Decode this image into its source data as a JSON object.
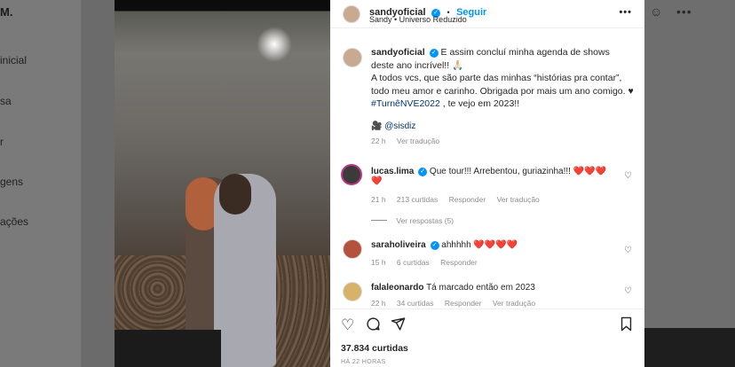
{
  "background": {
    "logo_fragment": "M.",
    "nav": [
      "inicial",
      "sa",
      "r",
      "gens",
      "ações"
    ]
  },
  "post": {
    "author": "sandyoficial",
    "dot": "•",
    "follow_label": "Seguir",
    "subtitle": "Sandy • Universo Reduzido",
    "more_icon": "•••"
  },
  "caption": {
    "username": "sandyoficial",
    "line1": "E assim concluí minha agenda de shows deste ano incrível!! 🙏🏻",
    "line2": "A todos vcs, que são parte das minhas “histórias pra contar”, todo meu amor e carinho. Obrigada por mais um ano comigo. ♥",
    "hashtag": "#TurnêNVE2022",
    "line3_rest": " , te vejo em 2023!!",
    "credit_icon": "🎥",
    "credit": "@sisdiz",
    "time": "22 h",
    "translate": "Ver tradução"
  },
  "comments": [
    {
      "username": "lucas.lima",
      "verified": true,
      "text": "Que tour!!! Arrebentou, guriazinha!!! ❤️❤️❤️",
      "text2": "❤️",
      "time": "21 h",
      "likes": "213 curtidas",
      "reply": "Responder",
      "translate": "Ver tradução",
      "view_replies": "Ver respostas (5)"
    },
    {
      "username": "saraholiveira",
      "verified": true,
      "text": "ahhhhh ❤️❤️❤️❤️",
      "time": "15 h",
      "likes": "6 curtidas",
      "reply": "Responder"
    },
    {
      "username": "falaleonardo",
      "verified": false,
      "text": "Tá marcado então em 2023",
      "time": "22 h",
      "likes": "34 curtidas",
      "reply": "Responder",
      "translate": "Ver tradução"
    }
  ],
  "actions": {
    "likes": "37.834 curtidas",
    "date": "HÁ 22 HORAS"
  },
  "colors": {
    "accent": "#0095f6",
    "heart": "#ed4956",
    "hashtag": "#00376b"
  }
}
